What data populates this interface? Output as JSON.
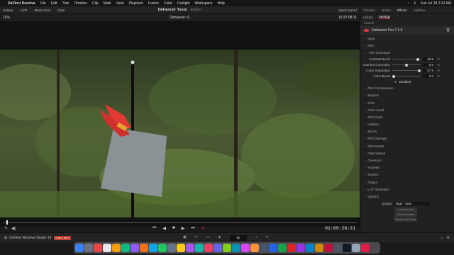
{
  "menubar": {
    "app": "DaVinci Resolve",
    "items": [
      "File",
      "Edit",
      "Trim",
      "Timeline",
      "Clip",
      "Mark",
      "View",
      "Playback",
      "Fusion",
      "Color",
      "Fairlight",
      "Workspace",
      "Help"
    ],
    "datetime": "Sun Jul 28  2:22 AM"
  },
  "toolbar": {
    "left": [
      "Gallery",
      "LUTs",
      "Media Pool",
      "Clips"
    ],
    "title": "Dehancer Tests",
    "title_status": "Edited",
    "right": [
      "Quick Export",
      "Timeline",
      "Nodes",
      "Effects",
      "Lightbox"
    ]
  },
  "viewer": {
    "zoom": "16%",
    "clip_name": "Dehancer v1",
    "timecode": "19:37:08:11",
    "playhead_timecode": "01:09:20:21"
  },
  "bottom": {
    "app_name": "DaVinci Resolve Studio 19",
    "badge": "PUBLIC BETA"
  },
  "panel": {
    "tabs": [
      "Library",
      "Settings"
    ],
    "search": "Search",
    "plugin_name": "Dehancer Pro 7.2.0",
    "sections_top": [
      "Input",
      "Film"
    ],
    "film_developer": "Film Developer",
    "params": [
      {
        "label": "Contrast Boost",
        "value": "46.8"
      },
      {
        "label": "Gamma Correction",
        "value": "0.0"
      },
      {
        "label": "Color Separation",
        "value": "57.8"
      },
      {
        "label": "Color Boost",
        "value": "0.0"
      }
    ],
    "enabled_label": "Enabled",
    "sections": [
      "Film Compression",
      "Expand",
      "Print",
      "Color Head",
      "Film Grain",
      "Halation",
      "Bloom",
      "Film Damage",
      "Film Breath",
      "Gate Weave",
      "Overscan",
      "Vignette",
      "Monitor",
      "Output",
      "LUT Generator",
      "Options"
    ],
    "quality_label": "Quality",
    "quality_value": "High - slow",
    "buttons": [
      "License info",
      "Check Profiles",
      "Disable All Tools"
    ]
  },
  "colors": {
    "accent": "#d4343e",
    "bg": "#1b1b1c",
    "panel": "#212122"
  }
}
